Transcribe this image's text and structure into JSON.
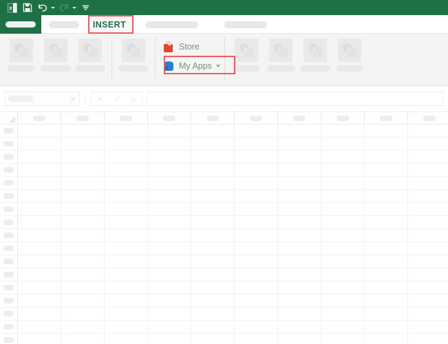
{
  "titlebar": {
    "background": "#1e7145",
    "quick_access": [
      {
        "name": "excel-logo-icon",
        "glyph": "X",
        "has_caret": false
      },
      {
        "name": "save-icon",
        "glyph": "💾",
        "has_caret": false
      },
      {
        "name": "undo-icon",
        "glyph": "↶",
        "has_caret": true
      },
      {
        "name": "redo-icon",
        "glyph": "↷",
        "has_caret": true
      },
      {
        "name": "customize-qat-icon",
        "glyph": "≡",
        "has_caret": false
      }
    ]
  },
  "tabs": [
    {
      "label": "",
      "name": "tab-file",
      "kind": "placeholder",
      "active": false
    },
    {
      "label": "",
      "name": "tab-home",
      "kind": "placeholder",
      "active": false
    },
    {
      "label": "INSERT",
      "name": "tab-insert",
      "kind": "text",
      "active": true
    },
    {
      "label": "",
      "name": "tab-page-layout",
      "kind": "placeholder",
      "active": false
    },
    {
      "label": "",
      "name": "tab-formulas",
      "kind": "placeholder",
      "active": false
    }
  ],
  "highlight": {
    "color": "#f4575c",
    "targets": [
      "tab-insert",
      "my-apps-button"
    ]
  },
  "ribbon": {
    "background": "#f4f4f4",
    "groups": [
      {
        "name": "group-tables",
        "buttons": [
          {
            "name": "ribbon-button-1",
            "label": ""
          },
          {
            "name": "ribbon-button-2",
            "label": ""
          },
          {
            "name": "ribbon-button-3",
            "label": ""
          }
        ]
      },
      {
        "name": "group-illustrations",
        "buttons": [
          {
            "name": "ribbon-button-4",
            "label": ""
          }
        ]
      },
      {
        "name": "group-addins",
        "addins": [
          {
            "name": "store-button",
            "label": "Store",
            "icon": "shopping-bag-icon",
            "icon_color": "#e8442b",
            "has_caret": false,
            "highlighted": false
          },
          {
            "name": "my-apps-button",
            "label": "My Apps",
            "icon": "app-box-icon",
            "icon_color": "#2b7cd3",
            "has_caret": true,
            "highlighted": true
          }
        ]
      },
      {
        "name": "group-charts",
        "buttons": [
          {
            "name": "ribbon-button-5",
            "label": ""
          },
          {
            "name": "ribbon-button-6",
            "label": ""
          },
          {
            "name": "ribbon-button-7",
            "label": ""
          },
          {
            "name": "ribbon-button-8",
            "label": ""
          }
        ]
      }
    ]
  },
  "formula_bar": {
    "name_box": {
      "name": "name-box",
      "value": "",
      "placeholder": ""
    },
    "buttons": [
      {
        "name": "cancel-entry-button",
        "glyph": "✕"
      },
      {
        "name": "confirm-entry-button",
        "glyph": "✓"
      },
      {
        "name": "insert-function-button",
        "glyph": "fx"
      }
    ],
    "input": {
      "name": "formula-input",
      "value": "",
      "placeholder": ""
    }
  },
  "grid": {
    "columns": 10,
    "rows": 17,
    "column_headers": [
      "",
      "",
      "",
      "",
      "",
      "",
      "",
      "",
      "",
      ""
    ],
    "row_headers": [
      "",
      "",
      "",
      "",
      "",
      "",
      "",
      "",
      "",
      "",
      "",
      "",
      "",
      "",
      "",
      "",
      ""
    ]
  }
}
